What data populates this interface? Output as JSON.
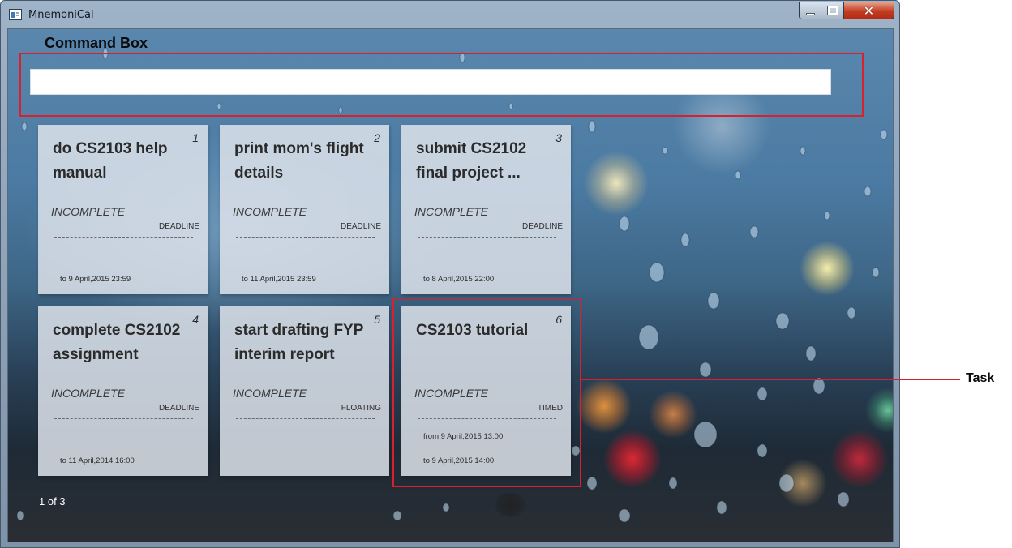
{
  "window": {
    "title": "MnemoniCal",
    "controls": {
      "minimize": "minimize-icon",
      "maximize": "maximize-icon",
      "close": "close-icon",
      "close_glyph": "✕"
    }
  },
  "command_box": {
    "title": "Command Box",
    "value": "",
    "placeholder": "",
    "chevron": "‹"
  },
  "tasks": [
    {
      "number": "1",
      "title": "do CS2103 help manual",
      "status": "INCOMPLETE",
      "type": "DEADLINE",
      "from": "",
      "to": "to 9 April,2015 23:59"
    },
    {
      "number": "2",
      "title": "print mom's flight details",
      "status": "INCOMPLETE",
      "type": "DEADLINE",
      "from": "",
      "to": "to 11 April,2015 23:59"
    },
    {
      "number": "3",
      "title": "submit CS2102 final project ...",
      "status": "INCOMPLETE",
      "type": "DEADLINE",
      "from": "",
      "to": "to 8 April,2015 22:00"
    },
    {
      "number": "4",
      "title": "complete CS2102 assignment",
      "status": "INCOMPLETE",
      "type": "DEADLINE",
      "from": "",
      "to": "to 11 April,2014 16:00"
    },
    {
      "number": "5",
      "title": "start drafting FYP interim report",
      "status": "INCOMPLETE",
      "type": "FLOATING",
      "from": "",
      "to": ""
    },
    {
      "number": "6",
      "title": "CS2103 tutorial",
      "status": "INCOMPLETE",
      "type": "TIMED",
      "from": "from 9 April,2015 13:00",
      "to": "to 9 April,2015 14:00"
    }
  ],
  "card_rule": "---------------------------------------------",
  "pager": {
    "text": "1 of 3"
  },
  "annotations": {
    "task_label": "Task",
    "color": "#d8202e"
  }
}
